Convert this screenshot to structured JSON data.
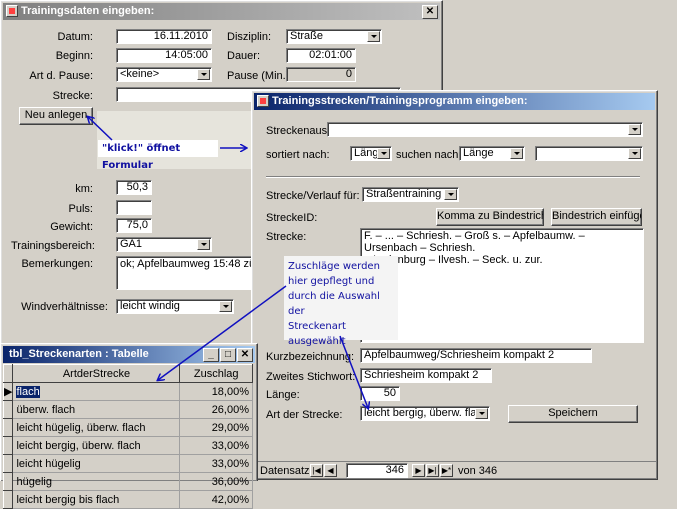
{
  "win1": {
    "title": "Trainingsdaten eingeben:",
    "datum_label": "Datum:",
    "datum_value": "16.11.2010",
    "beginn_label": "Beginn:",
    "beginn_value": "14:05:00",
    "pause_label": "Art d. Pause:",
    "pause_value": "<keine>",
    "strecke_label": "Strecke:",
    "disziplin_label": "Disziplin:",
    "disziplin_value": "Straße",
    "dauer_label": "Dauer:",
    "dauer_value": "02:01:00",
    "pausemin_label": "Pause (Min.):",
    "pausemin_value": "0",
    "neu_button": "Neu anlegen",
    "km_label": "km:",
    "km_value": "50,3",
    "puls_label": "Puls:",
    "puls_value": "",
    "gewicht_label": "Gewicht:",
    "gewicht_value": "75,0",
    "bereich_label": "Trainingsbereich:",
    "bereich_value": "GA1",
    "bemerk_label": "Bemerkungen:",
    "bemerk_value": "ok; Apfelbaumweg 15:48 zügig",
    "wind_label": "Windverhältnisse:",
    "wind_value": "leicht windig"
  },
  "annotations": {
    "klick": "\"klick!\" öffnet Formular",
    "zuschlag_lines": [
      "Zuschläge werden",
      "hier gepflegt und",
      "durch die Auswahl der",
      "Streckenart",
      "ausgewählt"
    ]
  },
  "win2": {
    "title": "Trainingsstrecken/Trainingsprogramm eingeben:",
    "streckenausw_label": "Streckenausw.",
    "streckenausw_value": "",
    "sortiert_label": "sortiert nach:",
    "sortiert_value": "Länge",
    "suchen_label": "suchen nach:",
    "suchen_value": "Länge",
    "suchen_text": "",
    "verlauf_label": "Strecke/Verlauf für:",
    "verlauf_value": "Straßentraining",
    "streckeid_label": "StreckeID:",
    "komma_button": "Komma zu Bindestrich",
    "bindestrich_button": "Bindestrich einfügen",
    "strecke_label": "Strecke:",
    "strecke_lines": [
      "F. – ... – Schriesh. – Groß s. – Apfelbaumw. – Ursenbach – Schriesh.",
      "– Ladenburg – Ilvesh. – Seck. u. zur."
    ],
    "kurz_label": "Kurzbezeichnung:",
    "kurz_value": "Apfelbaumweg/Schriesheim kompakt 2",
    "stich_label": "Zweites Stichwort:",
    "stich_value": "Schriesheim kompakt 2",
    "laenge_label": "Länge:",
    "laenge_value": "50",
    "art_label": "Art der Strecke:",
    "art_value": "leicht bergig, überw. flach",
    "speichern_button": "Speichern",
    "nav_label": "Datensatz:",
    "nav_current": "346",
    "nav_of": "von  346"
  },
  "win3": {
    "title": "tbl_Streckenarten : Tabelle",
    "headers": [
      "ArtderStrecke",
      "Zuschlag"
    ],
    "rows": [
      [
        "flach",
        "18,00%"
      ],
      [
        "überw. flach",
        "26,00%"
      ],
      [
        "leicht hügelig, überw. flach",
        "29,00%"
      ],
      [
        "leicht bergig, überw. flach",
        "33,00%"
      ],
      [
        "leicht hügelig",
        "33,00%"
      ],
      [
        "hügelig",
        "36,00%"
      ],
      [
        "leicht bergig bis flach",
        "42,00%"
      ]
    ]
  }
}
